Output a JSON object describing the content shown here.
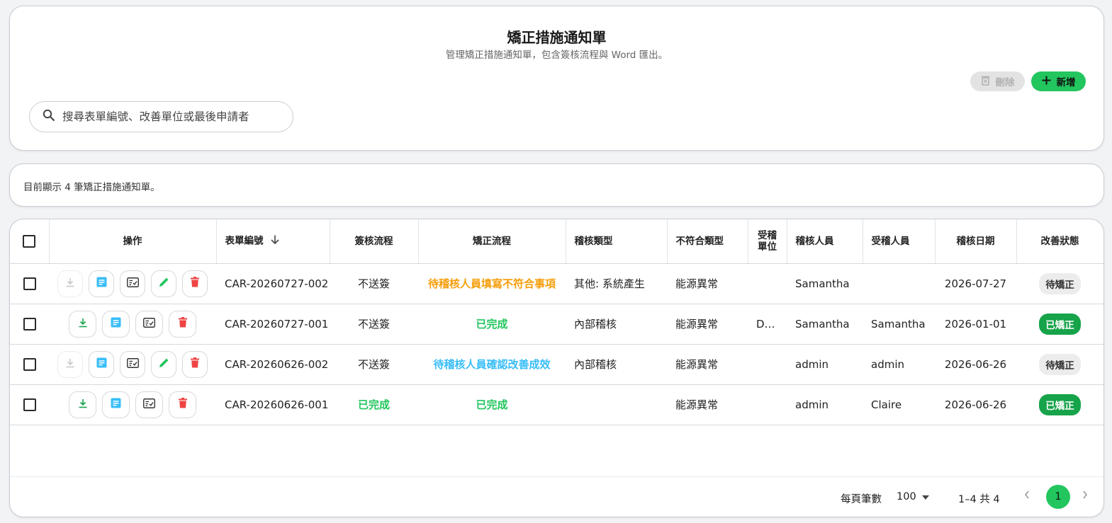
{
  "header": {
    "title": "矯正措施通知單",
    "subtitle": "管理矯正措施通知單，包含簽核流程與 Word 匯出。",
    "delete_label": "刪除",
    "add_label": "新增",
    "search_placeholder": "搜尋表單編號、改善單位或最後申請者"
  },
  "info": {
    "text": "目前顯示 4 筆矯正措施通知單。"
  },
  "table": {
    "columns": {
      "actions": "操作",
      "form_no": "表單編號",
      "sign_flow": "簽核流程",
      "correct_flow": "矯正流程",
      "audit_type": "稽核類型",
      "nc_type": "不符合類型",
      "audited_unit_l1": "受稽",
      "audited_unit_l2": "單位",
      "auditor": "稽核人員",
      "auditee": "受稽人員",
      "audit_date": "稽核日期",
      "status": "改善狀態"
    },
    "rows": [
      {
        "form_no": "CAR-20260727-002",
        "sign_flow": "不送簽",
        "correct_flow": "待稽核人員填寫不符合事項",
        "audit_type": "其他: 系統產生",
        "nc_type": "能源異常",
        "unit": "",
        "auditor": "Samantha",
        "auditee": "",
        "date": "2026-07-27",
        "status": "待矯正"
      },
      {
        "form_no": "CAR-20260727-001",
        "sign_flow": "不送簽",
        "correct_flow": "已完成",
        "audit_type": "內部稽核",
        "nc_type": "能源異常",
        "unit": "D…",
        "auditor": "Samantha",
        "auditee": "Samantha",
        "date": "2026-01-01",
        "status": "已矯正"
      },
      {
        "form_no": "CAR-20260626-002",
        "sign_flow": "不送簽",
        "correct_flow": "待稽核人員確認改善成效",
        "audit_type": "內部稽核",
        "nc_type": "能源異常",
        "unit": "",
        "auditor": "admin",
        "auditee": "admin",
        "date": "2026-06-26",
        "status": "待矯正"
      },
      {
        "form_no": "CAR-20260626-001",
        "sign_flow": "已完成",
        "correct_flow": "已完成",
        "audit_type": "",
        "nc_type": "能源異常",
        "unit": "",
        "auditor": "admin",
        "auditee": "Claire",
        "date": "2026-06-26",
        "status": "已矯正"
      }
    ]
  },
  "pagination": {
    "per_page_label": "每頁筆數",
    "per_page_value": "100",
    "range_text": "1–4 共 4",
    "current_page": "1"
  },
  "colors": {
    "accent_green": "#22c55e",
    "status_done": "#16a34a",
    "flow_pending_orange": "#f59e0b",
    "flow_pending_blue": "#38bdf8",
    "delete_red": "#ef4444",
    "doc_blue": "#38bdf8"
  },
  "icons": [
    "search-icon",
    "trash-outline-icon",
    "plus-icon",
    "download-icon",
    "document-icon",
    "checklist-icon",
    "pencil-icon",
    "trash-icon",
    "sort-down-icon",
    "dropdown-arrow-icon",
    "chevron-left-icon",
    "chevron-right-icon"
  ]
}
